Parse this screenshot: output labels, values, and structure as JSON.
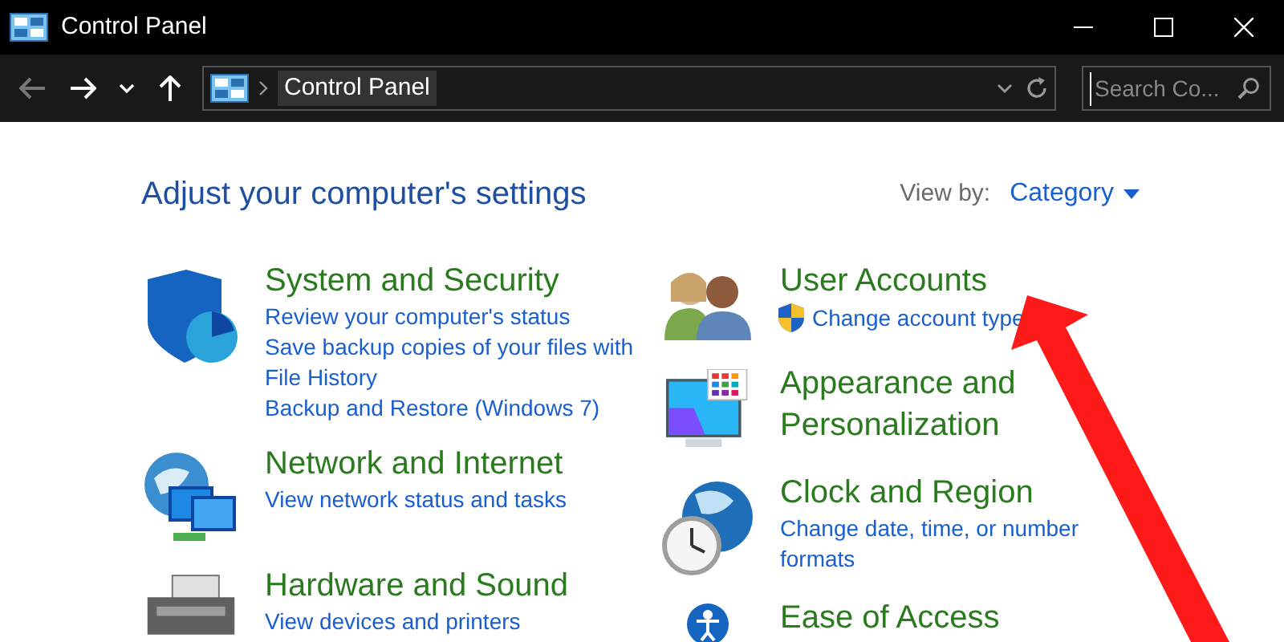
{
  "window": {
    "title": "Control Panel"
  },
  "address_bar": {
    "path": "Control Panel"
  },
  "search": {
    "placeholder": "Search Co..."
  },
  "heading": "Adjust your computer's settings",
  "view_by": {
    "label": "View by:",
    "value": "Category"
  },
  "columns": [
    {
      "categories": [
        {
          "title": "System and Security",
          "links": [
            {
              "text": "Review your computer's status",
              "kind": "plain"
            },
            {
              "text": "Save backup copies of your files with File History",
              "kind": "plain"
            },
            {
              "text": "Backup and Restore (Windows 7)",
              "kind": "plain"
            }
          ]
        },
        {
          "title": "Network and Internet",
          "links": [
            {
              "text": "View network status and tasks",
              "kind": "plain"
            }
          ]
        },
        {
          "title": "Hardware and Sound",
          "links": [
            {
              "text": "View devices and printers",
              "kind": "plain"
            }
          ]
        }
      ]
    },
    {
      "categories": [
        {
          "title": "User Accounts",
          "links": [
            {
              "text": "Change account type",
              "kind": "admin"
            }
          ]
        },
        {
          "title": "Appearance and Personalization"
        },
        {
          "title": "Clock and Region",
          "links": [
            {
              "text": "Change date, time, or number formats",
              "kind": "plain"
            }
          ]
        },
        {
          "title": "Ease of Access"
        }
      ]
    }
  ]
}
